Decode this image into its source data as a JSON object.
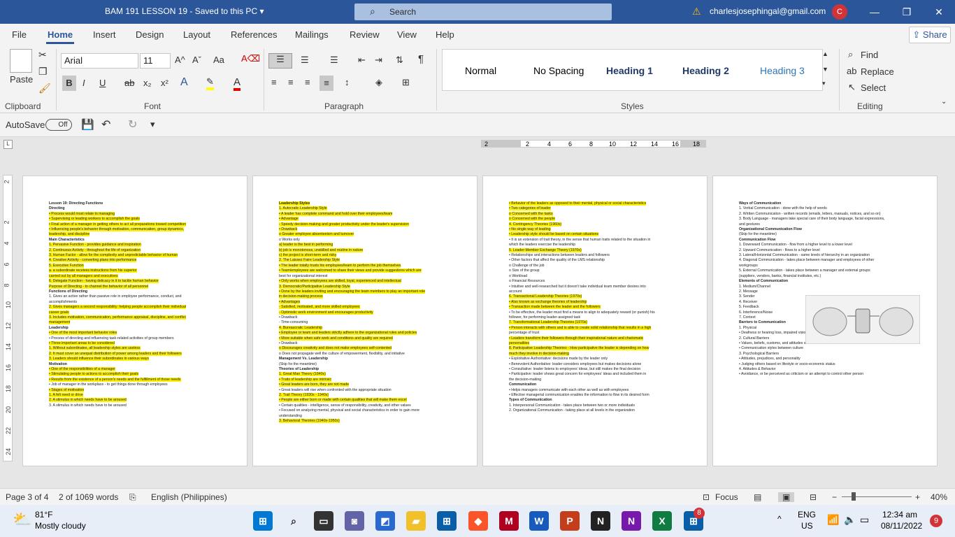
{
  "titlebar": {
    "doc_title": "BAM 191 LESSON 19  -  Saved to this PC  ▾",
    "search_placeholder": "Search",
    "user_email": "charlesjosephingal@gmail.com",
    "avatar_initial": "C",
    "minimize": "—",
    "restore": "❐",
    "close": "✕"
  },
  "menu": {
    "tabs": [
      "File",
      "Home",
      "Insert",
      "Design",
      "Layout",
      "References",
      "Mailings",
      "Review",
      "View",
      "Help"
    ],
    "share": "Share"
  },
  "ribbon": {
    "clipboard": {
      "paste": "Paste",
      "label": "Clipboard"
    },
    "font": {
      "family": "Arial",
      "size": "11",
      "label": "Font",
      "bold": "B",
      "italic": "I",
      "underline": "U",
      "strike": "ab",
      "subscript": "x₂",
      "superscript": "x²"
    },
    "paragraph": {
      "label": "Paragraph"
    },
    "styles": {
      "items": [
        "Normal",
        "No Spacing",
        "Heading 1",
        "Heading 2",
        "Heading 3"
      ],
      "label": "Styles"
    },
    "editing": {
      "find": "Find",
      "replace": "Replace",
      "select": "Select",
      "label": "Editing"
    }
  },
  "qat": {
    "autosave": "AutoSave",
    "toggle": "Off"
  },
  "ruler": {
    "h_ticks": [
      "2",
      "2",
      "4",
      "6",
      "8",
      "10",
      "12",
      "14",
      "16",
      "18"
    ],
    "v_ticks": [
      "2",
      "2",
      "4",
      "6",
      "8",
      "10",
      "12",
      "14",
      "16",
      "18",
      "20",
      "22",
      "24"
    ]
  },
  "pages": [
    {
      "lines": [
        {
          "t": "Lesson 19: Directing Functions",
          "s": "h"
        },
        {
          "t": "Directing",
          "s": "h"
        },
        {
          "t": "   •  Process would most relate to managing",
          "s": "hl"
        },
        {
          "t": "   •  Supervising or leading workers to accomplish the goals",
          "s": "hl"
        },
        {
          "t": "   •  Final action of a manager in getting others to act all preparations toward competition",
          "s": "hl"
        },
        {
          "t": "   •  Influencing people's behavior through motivation, communication, group dynamics,",
          "s": "hl"
        },
        {
          "t": "       leadership, and discipline",
          "s": "hl"
        },
        {
          "t": "Main Characteristics",
          "s": "h"
        },
        {
          "t": "   1.  Pervasive Function - provides guidance and inspiration",
          "s": "hl"
        },
        {
          "t": "   2.  Continuous Activity - throughout the life of organization",
          "s": "hl"
        },
        {
          "t": "   3.  Human Factor - allow for the complexity and unpredictable behavior of human",
          "s": "hl"
        },
        {
          "t": "   4.  Creative Activity - converting plans into performance",
          "s": "hl"
        },
        {
          "t": "   5.  Executive Function",
          "s": "hl"
        },
        {
          "t": "          a.  a subordinate receives instructions from his superior",
          "s": "hl"
        },
        {
          "t": "          carried out by all managers and executives",
          "s": "hl"
        },
        {
          "t": "   6.  Delegate Function - having delicacy in it to tackle human behavior",
          "s": "hl"
        },
        {
          "t": "Purpose of Directing - to channel the behavior of all personnel",
          "s": "hl"
        },
        {
          "t": "Functions of Directing",
          "s": "h"
        },
        {
          "t": "   1.  Gives an active rather than passive role in employee performance, conduct, and",
          "s": ""
        },
        {
          "t": "       accomplishments",
          "s": ""
        },
        {
          "t": "   2.  Gives managers a second responsibility: helping people accomplish their individual",
          "s": "hl"
        },
        {
          "t": "       career goals",
          "s": "hl"
        },
        {
          "t": "   3.  Includes motivation, communication, performance appraisal, discipline, and conflict",
          "s": "hl"
        },
        {
          "t": "       management",
          "s": "hl"
        },
        {
          "t": "Leadership",
          "s": "h"
        },
        {
          "t": "   •  One of the most important behavior roles",
          "s": "hl"
        },
        {
          "t": "   •  Process of directing and influencing task-related activities of group members",
          "s": ""
        },
        {
          "t": "   •  Three important areas to be considered",
          "s": "hl"
        },
        {
          "t": "          1.  Without subordinates, all leadership styles are useless",
          "s": "hl"
        },
        {
          "t": "          2.  It must cover an unequal distribution of power among leaders and their followers",
          "s": "hl"
        },
        {
          "t": "          3.  Leaders should influence their subordinates in various ways",
          "s": "hl"
        },
        {
          "t": "Motivation",
          "s": "h"
        },
        {
          "t": "   •  One of the responsibilities of a manager",
          "s": "hl"
        },
        {
          "t": "   •  Stimulating people to actions to accomplish their goals",
          "s": "hl"
        },
        {
          "t": "   •  Results from the existence of a person's needs and the fulfillment of those needs",
          "s": "hl"
        },
        {
          "t": "   •  Job of manager in the workplace - to get things done through employees",
          "s": ""
        },
        {
          "t": "   •  Stages of motivation",
          "s": "hl"
        },
        {
          "t": "          1.  A felt need or drive",
          "s": "hl"
        },
        {
          "t": "          2.  A stimulus in which needs have to be aroused",
          "s": "hl"
        },
        {
          "t": "          3.  A stimulus in which needs have to be aroused",
          "s": ""
        }
      ]
    },
    {
      "lines": [
        {
          "t": "Leadership Styles",
          "s": "h hl"
        },
        {
          "t": "   1.  Autocratic Leadership Style",
          "s": "hl"
        },
        {
          "t": "   •  A leader has complete command and hold over their employees/team",
          "s": "hl"
        },
        {
          "t": "   •  Advantage",
          "s": "hl"
        },
        {
          "t": "          -  Speedy decision-making and greater productivity under the leader's supervision",
          "s": "hl"
        },
        {
          "t": "   •  Drawback",
          "s": "hl"
        },
        {
          "t": "          o  Greater employee absenteeism and turnover",
          "s": "hl"
        },
        {
          "t": "          o  Works only",
          "s": ""
        },
        {
          "t": "               a)  leader is the best in performing",
          "s": "hl"
        },
        {
          "t": "               b)  job is monotonous, unskilled and routine in nature",
          "s": "hl"
        },
        {
          "t": "               c)  the project is short-term and risky",
          "s": "hl"
        },
        {
          "t": "   2.  The Laissez Faire Leadership Style",
          "s": "hl"
        },
        {
          "t": "   •  The leader totally trusts his employees/team to perform the job themselves",
          "s": "hl"
        },
        {
          "t": "   •  Team/employees are welcomed to share their views and provide suggestions which are",
          "s": "hl"
        },
        {
          "t": "       best for organizational interest",
          "s": ""
        },
        {
          "t": "   •  Only works when employees are skilled, loyal, experienced and intellectual",
          "s": "hl"
        },
        {
          "t": "   3.  Democratic/Participative Leadership Style",
          "s": "hl"
        },
        {
          "t": "   •  Done by the leaders inviting and encouraging the team members to play an important role",
          "s": "hl"
        },
        {
          "t": "       in decision-making process",
          "s": "hl"
        },
        {
          "t": "   •  Advantages",
          "s": "hl"
        },
        {
          "t": "          -  Satisfied, motivated, and more skilled employees",
          "s": "hl"
        },
        {
          "t": "          -  Optimistic work environment and encourages productivity",
          "s": "hl"
        },
        {
          "t": "   •  Drawback",
          "s": ""
        },
        {
          "t": "          -  Time-consuming",
          "s": ""
        },
        {
          "t": "   4.  Bureaucratic Leadership",
          "s": "hl"
        },
        {
          "t": "   •  Employee or team and leaders strictly adhere to the organizational rules and policies",
          "s": "hl"
        },
        {
          "t": "   •  More suitable when safe work and conditions and quality are required",
          "s": "hl"
        },
        {
          "t": "   •  Drawback",
          "s": ""
        },
        {
          "t": "          o  Discourages creativity and does not make employees self-contented",
          "s": "hl"
        },
        {
          "t": "          o  Does not propagate well the culture of empowerment, flexibility, and initiative",
          "s": ""
        },
        {
          "t": " ",
          "s": ""
        },
        {
          "t": "Management Vs. Leadership",
          "s": "h"
        },
        {
          "t": "(Skip for the meantime)",
          "s": ""
        },
        {
          "t": " ",
          "s": ""
        },
        {
          "t": "Theories of Leadership",
          "s": "h"
        },
        {
          "t": "   1.  Great Man Theory (1840s)",
          "s": "hl"
        },
        {
          "t": "   •  Traits of leadership are intrinsic",
          "s": "hl"
        },
        {
          "t": "   •  Great leaders are born, they are not made",
          "s": "hl"
        },
        {
          "t": "   •  Great leaders will rise when confronted with the appropriate situation",
          "s": ""
        },
        {
          "t": "   2.  Trait Theory (1930s - 1940s)",
          "s": "hl"
        },
        {
          "t": "   •  People are either born or made with certain qualities that will make them excel",
          "s": "hl"
        },
        {
          "t": "   •  Certain qualities - intelligence, sense of responsibility, creativity, and other values",
          "s": ""
        },
        {
          "t": "   •  Focused on analyzing mental, physical and social characteristics in order to gain more",
          "s": ""
        },
        {
          "t": "       understanding",
          "s": ""
        },
        {
          "t": "   3.  Behavioral Theories (1940s-1950s)",
          "s": "hl"
        }
      ]
    },
    {
      "lines": [
        {
          "t": "   •  Behavior of the leaders as opposed to their mental, physical or social characteristics",
          "s": "hl"
        },
        {
          "t": "   •  Two categories of leader",
          "s": "hl"
        },
        {
          "t": "          o  Concerned with the tasks",
          "s": "hl"
        },
        {
          "t": "          o  Concerned with the people",
          "s": "hl"
        },
        {
          "t": "   4.  Contingency Theories (1960s)",
          "s": "hl"
        },
        {
          "t": "   •  No single way of leading",
          "s": "hl"
        },
        {
          "t": "   •  Leadership style should be based on certain situations",
          "s": "hl"
        },
        {
          "t": "   •  It is an extension of trait theory, in the sense that human traits related to the situation in",
          "s": ""
        },
        {
          "t": "       which the leaders exercise the leadership",
          "s": ""
        },
        {
          "t": "   5.  Leader-Member Exchange Theory (1970s)",
          "s": "hl"
        },
        {
          "t": "   •  Relationships and interactions between leaders and followers",
          "s": ""
        },
        {
          "t": "   •  Other factors that affect the quality of the LMS relationship",
          "s": ""
        },
        {
          "t": "          o  Challenge of the job",
          "s": ""
        },
        {
          "t": "          o  Size of the group",
          "s": ""
        },
        {
          "t": "          o  Workload",
          "s": ""
        },
        {
          "t": "          o  Financial Resources",
          "s": ""
        },
        {
          "t": "   •  Intuitive and well-researched but it doesn't take individual team member desires into",
          "s": ""
        },
        {
          "t": "       account",
          "s": ""
        },
        {
          "t": "   6.  Transactional Leadership Theories (1970s)",
          "s": "hl"
        },
        {
          "t": "   •  Also known as exchange theories of leadership",
          "s": "hl"
        },
        {
          "t": "   •  Transaction made between the leader and the followers",
          "s": "hl"
        },
        {
          "t": "   •  To be effective, the leader must find a means to align to adequately reward (or punish) his",
          "s": ""
        },
        {
          "t": "       follower, for performing leader-assigned task",
          "s": ""
        },
        {
          "t": "   7.  Transformational Leadership Theories (1970s)",
          "s": "hl"
        },
        {
          "t": "   •  Person interacts with others and is able to create solid relationship that results in a high",
          "s": "hl"
        },
        {
          "t": "       percentage of trust",
          "s": ""
        },
        {
          "t": "   •  Leaders transform their followers through their inspirational nature and charismatic",
          "s": "hl"
        },
        {
          "t": "       personalities",
          "s": "hl"
        },
        {
          "t": "   8.  Participative Leadership Theories - How participative the leader is depending on how",
          "s": "hl"
        },
        {
          "t": "       much they involve in decision-making",
          "s": "hl"
        },
        {
          "t": "          •  Exploitative Authoritative: decisions made by the leader only",
          "s": ""
        },
        {
          "t": "          •  Benevolent Authoritative: leader considers employees but makes decisions alone",
          "s": ""
        },
        {
          "t": "          •  Consultative: leader listens to employees' ideas, but still makes the final decision",
          "s": ""
        },
        {
          "t": "          •  Participative: leader shows great concern for employees' ideas and included them in",
          "s": ""
        },
        {
          "t": "              the decision-making",
          "s": ""
        },
        {
          "t": "Communication",
          "s": "h"
        },
        {
          "t": "   •  Helps managers communicate with each other as well as with employees",
          "s": ""
        },
        {
          "t": "   •  Effective managerial communication enables the information to flow in its desired form",
          "s": ""
        },
        {
          "t": "Types of Communication",
          "s": "h"
        },
        {
          "t": "   1.  Interpersonal Communication - takes place between two or more individuals",
          "s": ""
        },
        {
          "t": "   2.  Organizational Communication - taking place at all levels in the organization",
          "s": ""
        }
      ]
    },
    {
      "lines": [
        {
          "t": "Ways of Communication",
          "s": "h"
        },
        {
          "t": "   1.  Verbal Communication - done with the help of words",
          "s": ""
        },
        {
          "t": "   2.  Written Communication - written records (emails, letters, manuals, notices, and so on)",
          "s": ""
        },
        {
          "t": "   3.  Body Language - managers take special care of their body language, facial expressions,",
          "s": ""
        },
        {
          "t": "       and gestures",
          "s": ""
        },
        {
          "t": "Organizational Communication Flow",
          "s": "h"
        },
        {
          "t": "(Skip for the meantime)",
          "s": ""
        },
        {
          "t": "Communication Flow",
          "s": "h"
        },
        {
          "t": "   1.  Downward Communication - flow from a higher level to a lower level",
          "s": ""
        },
        {
          "t": "   2.  Upward Communication - flows to a higher level",
          "s": ""
        },
        {
          "t": "   3.  Lateral/Horizontal Communication - same levels of hierarchy in an organization",
          "s": ""
        },
        {
          "t": "   4.  Diagonal Communication - takes place between manager and employees of other",
          "s": ""
        },
        {
          "t": "       workgroups",
          "s": ""
        },
        {
          "t": "   5.  External Communication - takes place between a manager and external groups",
          "s": ""
        },
        {
          "t": "       (suppliers, vendors, banks, financial institutes, etc.)",
          "s": ""
        },
        {
          "t": "Elements of Communication",
          "s": "h"
        },
        {
          "t": "   1.  Medium/Channel",
          "s": ""
        },
        {
          "t": "   2.  Message",
          "s": ""
        },
        {
          "t": "   3.  Sender",
          "s": ""
        },
        {
          "t": "   4.  Receiver",
          "s": ""
        },
        {
          "t": "   5.  Feedback",
          "s": ""
        },
        {
          "t": "   6.  Interference/Noise",
          "s": ""
        },
        {
          "t": "   7.  Context",
          "s": ""
        },
        {
          "t": "Barriers to Communication",
          "s": "h"
        },
        {
          "t": "   1.  Physical",
          "s": ""
        },
        {
          "t": "   •  Deafness or hearing loss, impaired vision, or speech disabilities",
          "s": ""
        },
        {
          "t": "   2.  Cultural Barriers",
          "s": ""
        },
        {
          "t": "   •  Values, beliefs, customs, and attitudes shared",
          "s": ""
        },
        {
          "t": "   •  Communication styles between culture",
          "s": ""
        },
        {
          "t": "   3.  Psychological Barriers",
          "s": ""
        },
        {
          "t": "   •  Attitudes, prejudices, and personality",
          "s": ""
        },
        {
          "t": "   •  Judging others based on lifestyle or socio-economic status",
          "s": ""
        },
        {
          "t": "   4.  Attitudes & Behavior",
          "s": ""
        },
        {
          "t": "   •  Avoidance, or be perceived as criticism or an attempt to control other person",
          "s": ""
        }
      ]
    }
  ],
  "status": {
    "page": "Page 3 of 4",
    "words": "2 of 1069 words",
    "language": "English (Philippines)",
    "focus": "Focus",
    "zoom": "40%",
    "zoom_minus": "−",
    "zoom_plus": "+"
  },
  "taskbar": {
    "weather_temp": "81°F",
    "weather_desc": "Mostly cloudy",
    "lang": "ENG",
    "region": "US",
    "time": "12:34 am",
    "date": "08/11/2022",
    "badge": "9",
    "store_badge": "8"
  }
}
